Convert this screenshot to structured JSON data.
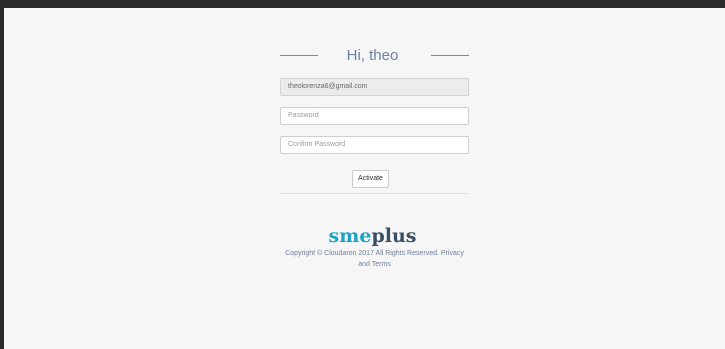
{
  "greeting": {
    "text": "Hi, theo"
  },
  "form": {
    "email_value": "theolorenza6@gmail.com",
    "password_placeholder": "Password",
    "confirm_placeholder": "Confirm Password",
    "activate_label": "Activate"
  },
  "footer": {
    "logo_part1": "sme",
    "logo_part2": "plus",
    "copyright_text": "Copyright © Cloudaron 2017 All Rights Reserved.",
    "privacy_label": "Privacy",
    "and_text": "and",
    "terms_label": "Terms"
  },
  "colors": {
    "brand_cyan": "#1ba3c8",
    "brand_dark": "#3a4d63",
    "text_muted": "#6d7f9b"
  }
}
